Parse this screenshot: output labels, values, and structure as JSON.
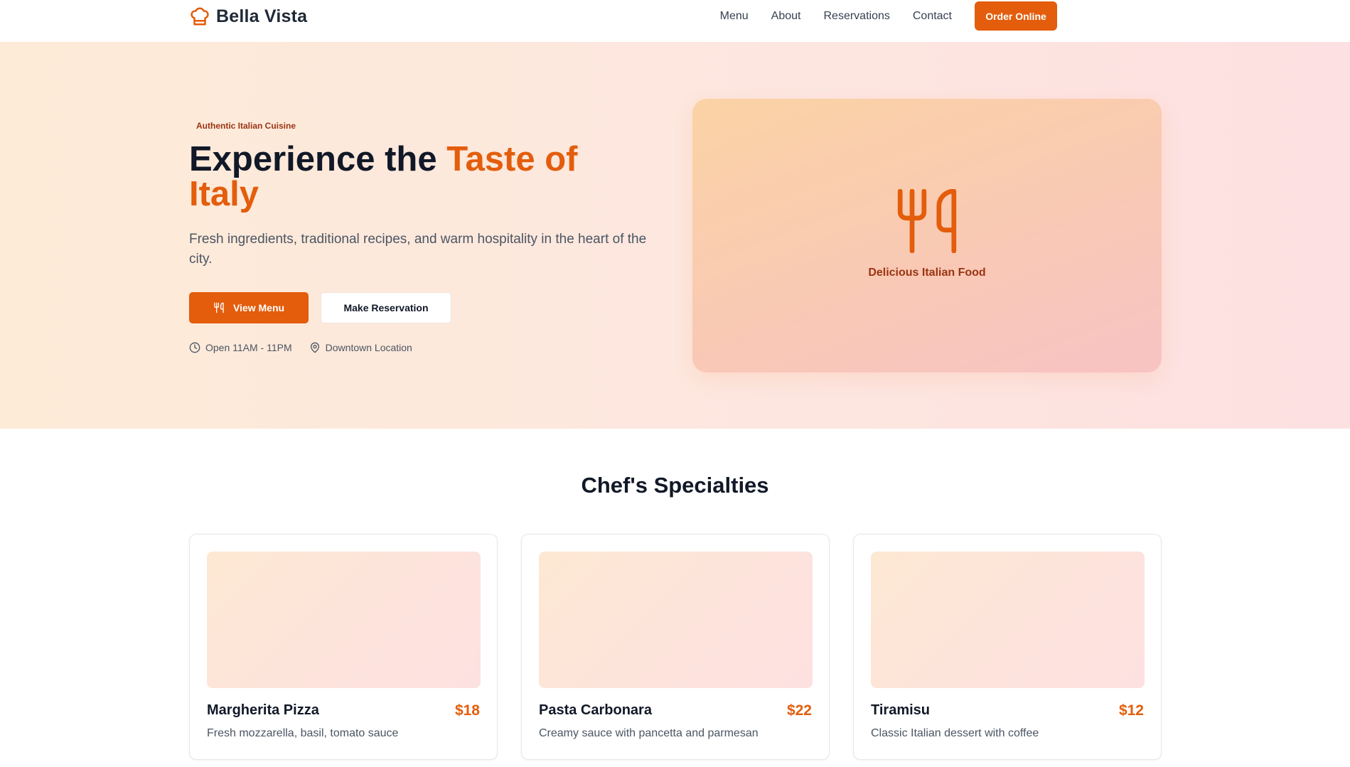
{
  "colors": {
    "accent": "#e35d0c",
    "accent_dark": "#9a3412",
    "text": "#111827",
    "muted": "#4b5563"
  },
  "nav": {
    "brand": "Bella Vista",
    "brand_icon": "chef-hat-icon",
    "links": [
      "Menu",
      "About",
      "Reservations",
      "Contact"
    ],
    "cta": "Order Online"
  },
  "hero": {
    "badge": "Authentic Italian Cuisine",
    "title_part1": "Experience the ",
    "title_accent": "Taste of Italy",
    "subtitle": "Fresh ingredients, traditional recipes, and warm hospitality in the heart of the city.",
    "primary_button": "View Menu",
    "primary_button_icon": "utensils-icon",
    "secondary_button": "Make Reservation",
    "hours": "Open 11AM - 11PM",
    "hours_icon": "clock-icon",
    "location": "Downtown Location",
    "location_icon": "map-pin-icon",
    "card_label": "Delicious Italian Food",
    "card_icon": "utensils-icon"
  },
  "specialties": {
    "title": "Chef's Specialties",
    "items": [
      {
        "name": "Margherita Pizza",
        "price": "$18",
        "description": "Fresh mozzarella, basil, tomato sauce"
      },
      {
        "name": "Pasta Carbonara",
        "price": "$22",
        "description": "Creamy sauce with pancetta and parmesan"
      },
      {
        "name": "Tiramisu",
        "price": "$12",
        "description": "Classic Italian dessert with coffee"
      }
    ]
  }
}
